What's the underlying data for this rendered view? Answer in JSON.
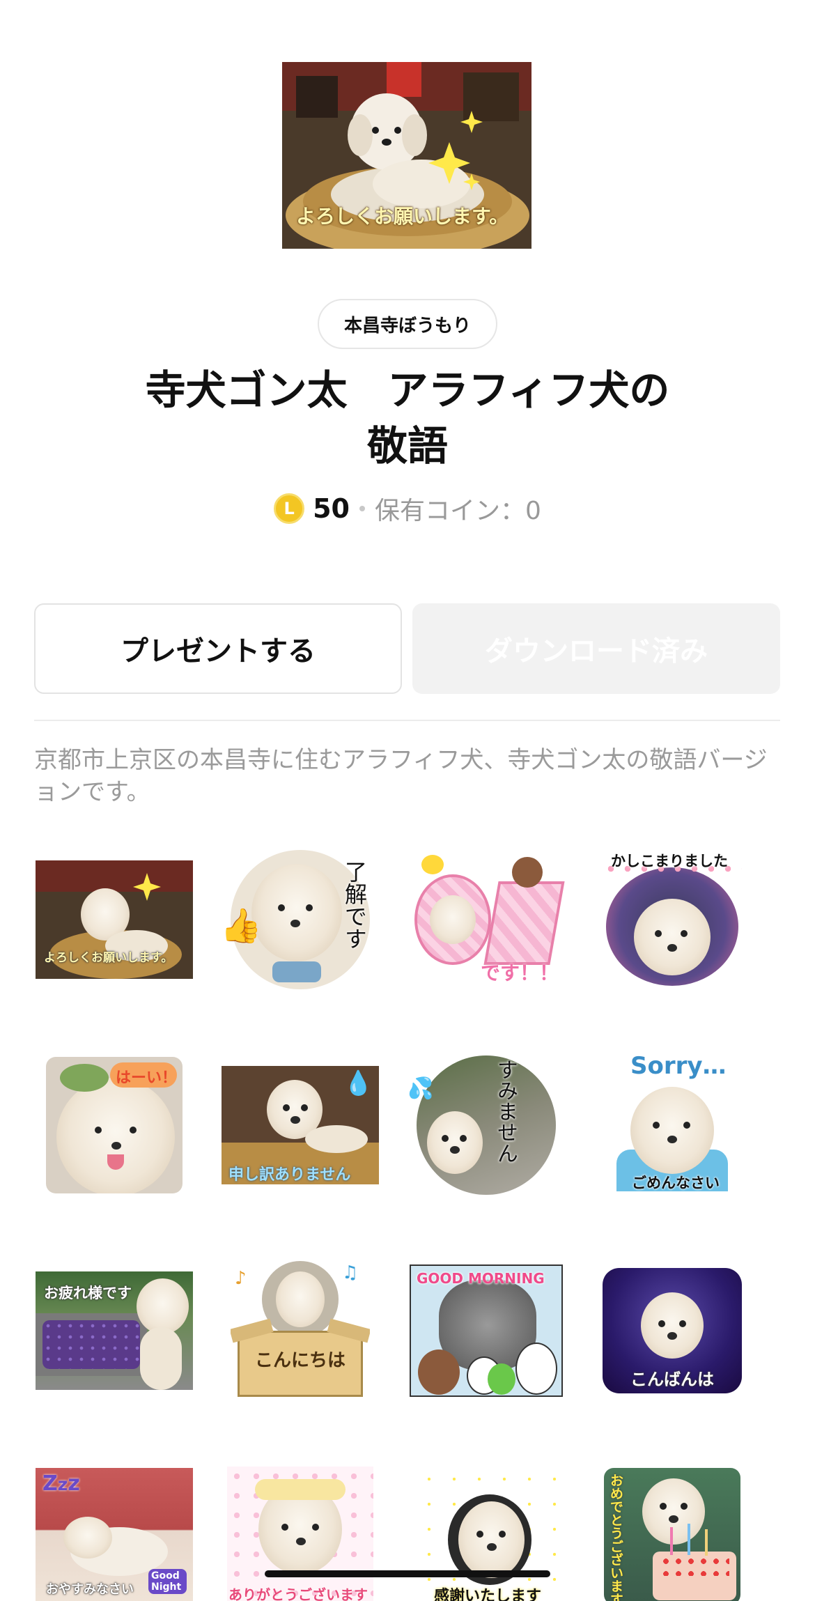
{
  "hero": {
    "caption": "よろしくお願いします。"
  },
  "author": "本昌寺ぼうもり",
  "title_lines": [
    "寺犬ゴン太　アラフィフ犬の",
    "敬語"
  ],
  "price": {
    "coin_symbol": "L",
    "amount": "50",
    "owned": "保有コイン：0"
  },
  "buttons": {
    "present": "プレゼントする",
    "download": "ダウンロード済み"
  },
  "description": "京都市上京区の本昌寺に住むアラフィフ犬、寺犬ゴン太の敬語バージョンです。",
  "stickers": [
    {
      "caption": "よろしくお願いします。"
    },
    {
      "caption": "了解です"
    },
    {
      "caption": "です！！"
    },
    {
      "caption": "かしこまりました"
    },
    {
      "caption": "はーい！"
    },
    {
      "caption": "申し訳ありません"
    },
    {
      "caption": "すみません"
    },
    {
      "caption": "Sorry…",
      "caption2": "ごめんなさい"
    },
    {
      "caption": "お疲れ様です"
    },
    {
      "caption": "こんにちは"
    },
    {
      "caption": "GOOD MORNING"
    },
    {
      "caption": "こんばんは"
    },
    {
      "caption": "おやすみなさい",
      "caption2": "Good Night"
    },
    {
      "caption": "ありがとうございます"
    },
    {
      "caption": "感謝いたします"
    },
    {
      "caption": "おめでとうございます"
    }
  ]
}
